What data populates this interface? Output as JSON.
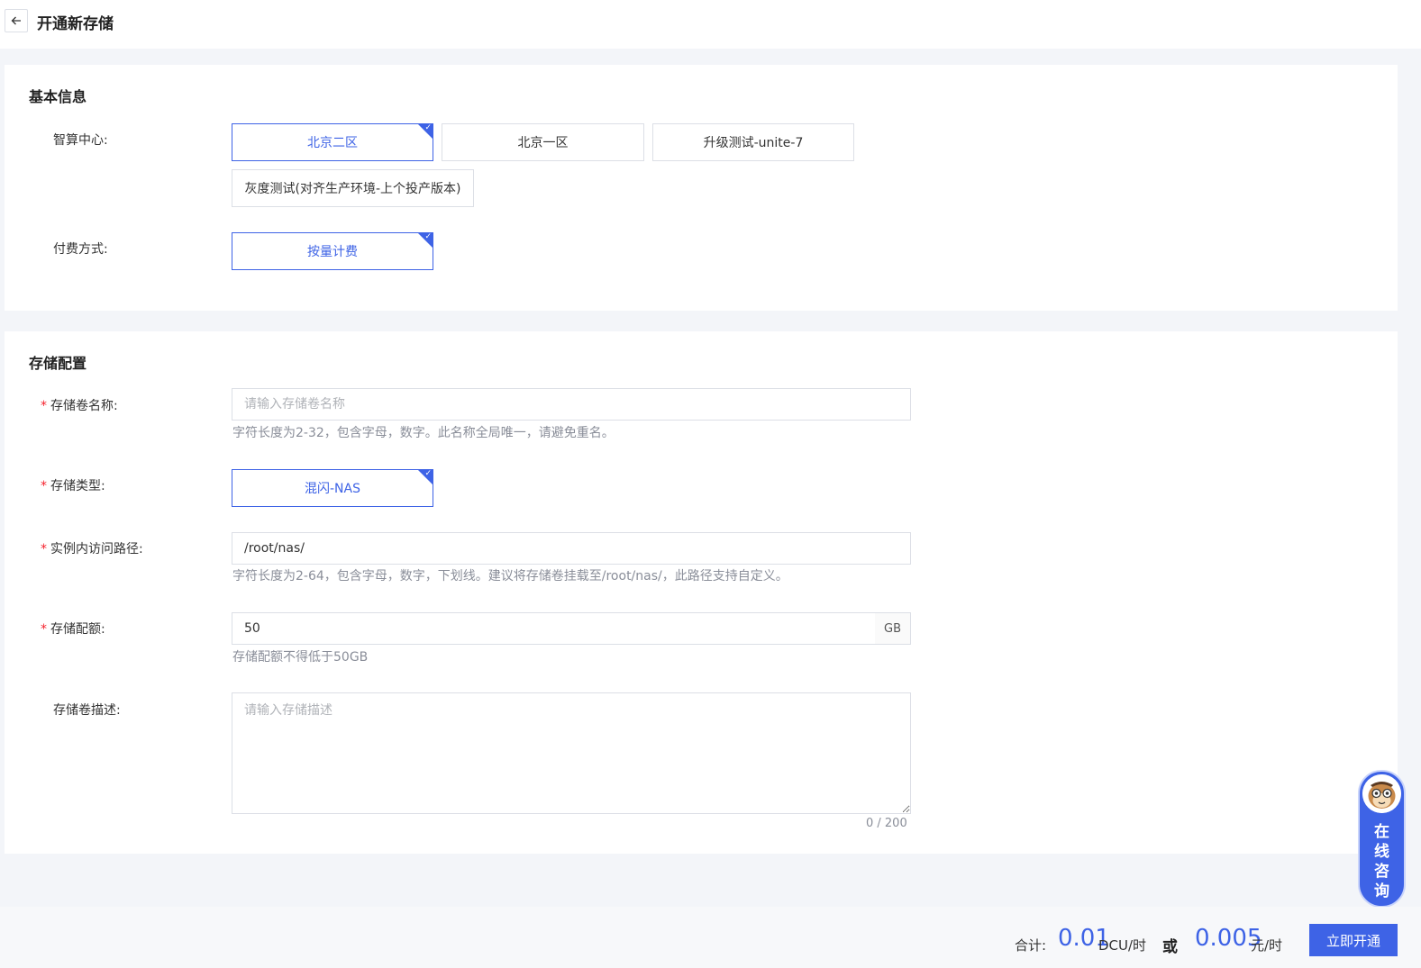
{
  "header": {
    "title": "开通新存储"
  },
  "basic": {
    "title": "基本信息",
    "center_label": "智算中心:",
    "centers": [
      {
        "label": "北京二区",
        "selected": true
      },
      {
        "label": "北京一区",
        "selected": false
      },
      {
        "label": "升级测试-unite-7",
        "selected": false
      },
      {
        "label": "灰度测试(对齐生产环境-上个投产版本)",
        "selected": false
      }
    ],
    "pay_label": "付费方式:",
    "pay_option": "按量计费"
  },
  "storage": {
    "title": "存储配置",
    "name_label": "存储卷名称:",
    "name_placeholder": "请输入存储卷名称",
    "name_hint": "字符长度为2-32，包含字母，数字。此名称全局唯一，请避免重名。",
    "type_label": "存储类型:",
    "type_option": "混闪-NAS",
    "path_label": "实例内访问路径:",
    "path_value": "/root/nas/",
    "path_hint": "字符长度为2-64，包含字母，数字，下划线。建议将存储卷挂载至/root/nas/，此路径支持自定义。",
    "quota_label": "存储配额:",
    "quota_value": "50",
    "quota_unit": "GB",
    "quota_hint": "存储配额不得低于50GB",
    "desc_label": "存储卷描述:",
    "desc_placeholder": "请输入存储描述",
    "desc_counter": "0 / 200"
  },
  "consult": {
    "label": "在线咨询"
  },
  "footer": {
    "total_label": "合计:",
    "price_dcu": "0.01",
    "unit_dcu": "DCU/时",
    "or": "或",
    "price_yuan": "0.005",
    "unit_yuan": "元/时",
    "submit": "立即开通"
  },
  "colors": {
    "accent": "#3e63e6",
    "required": "#f5222d"
  }
}
